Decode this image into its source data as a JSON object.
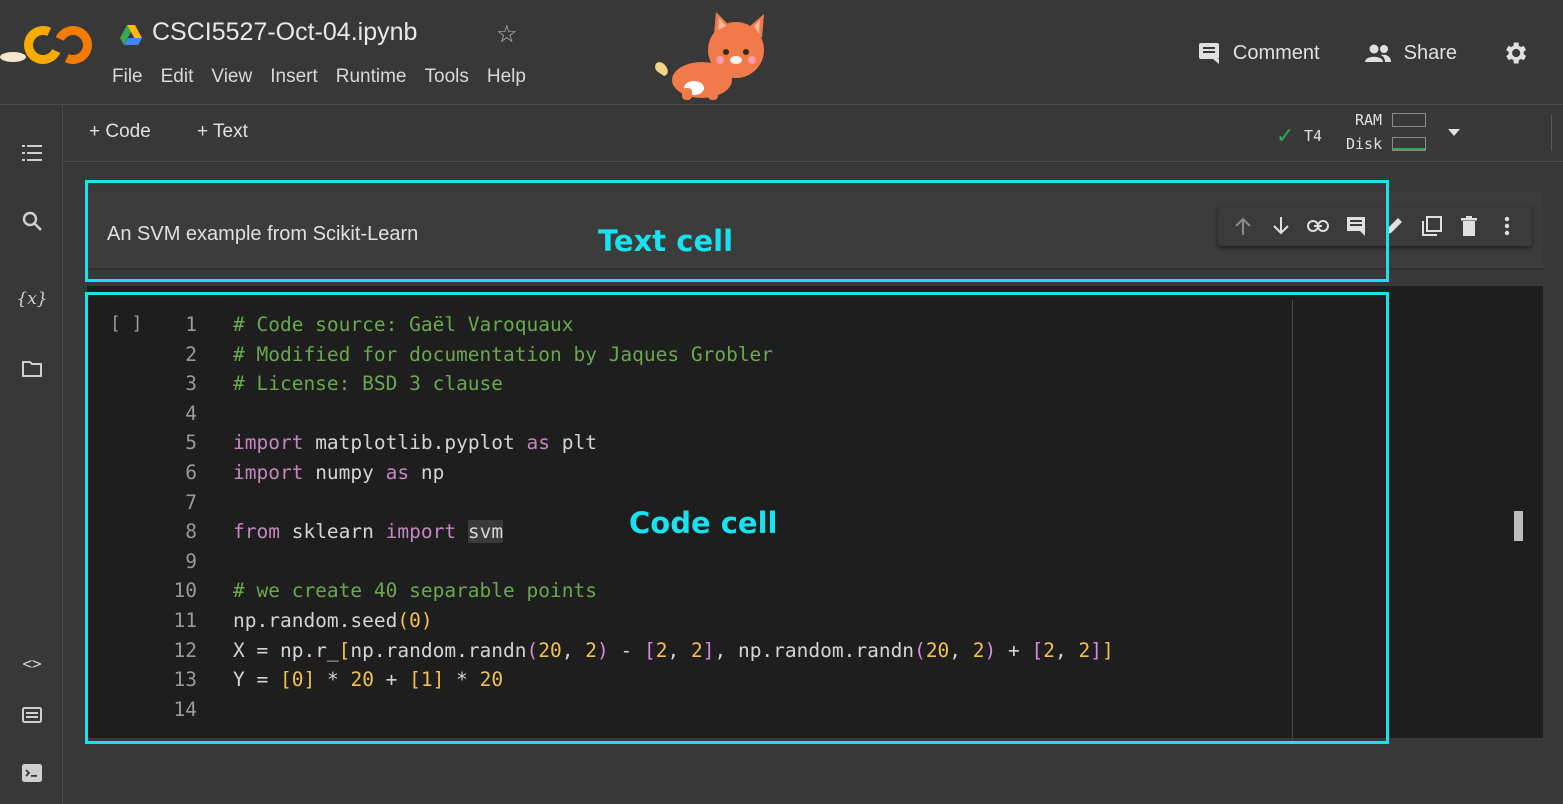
{
  "header": {
    "file_title": "CSCI5527-Oct-04.ipynb",
    "menus": [
      "File",
      "Edit",
      "View",
      "Insert",
      "Runtime",
      "Tools",
      "Help"
    ],
    "comment_label": "Comment",
    "share_label": "Share"
  },
  "toolbar": {
    "add_code_label": "+ Code",
    "add_text_label": "+ Text",
    "runtime_type": "T4",
    "ram_label": "RAM",
    "disk_label": "Disk"
  },
  "text_cell": {
    "content": "An SVM example from Scikit-Learn"
  },
  "code_cell": {
    "run_indicator": "[ ]",
    "lines": [
      {
        "num": "1",
        "text": "# Code source: Gaël Varoquaux"
      },
      {
        "num": "2",
        "text": "# Modified for documentation by Jaques Grobler"
      },
      {
        "num": "3",
        "text": "# License: BSD 3 clause"
      },
      {
        "num": "4",
        "text": ""
      },
      {
        "num": "5",
        "text": "import matplotlib.pyplot as plt"
      },
      {
        "num": "6",
        "text": "import numpy as np"
      },
      {
        "num": "7",
        "text": ""
      },
      {
        "num": "8",
        "text": "from sklearn import svm"
      },
      {
        "num": "9",
        "text": ""
      },
      {
        "num": "10",
        "text": "# we create 40 separable points"
      },
      {
        "num": "11",
        "text": "np.random.seed(0)"
      },
      {
        "num": "12",
        "text": "X = np.r_[np.random.randn(20, 2) - [2, 2], np.random.randn(20, 2) + [2, 2]]"
      },
      {
        "num": "13",
        "text": "Y = [0] * 20 + [1] * 20"
      },
      {
        "num": "14",
        "text": ""
      }
    ]
  },
  "annotations": {
    "text_cell_label": "Text cell",
    "code_cell_label": "Code cell"
  },
  "colors": {
    "annotation": "#19e2f0",
    "comment": "#6aa84f",
    "keyword": "#c586c0",
    "number": "#f2c14e",
    "bracket": "#d28adb",
    "connected_check": "#34a853"
  },
  "icons": [
    "colab-logo-icon",
    "drive-icon",
    "star-icon",
    "mascot-cat-icon",
    "comment-icon",
    "share-people-icon",
    "gear-icon",
    "toc-icon",
    "search-icon",
    "variables-icon",
    "folder-icon",
    "code-snippets-icon",
    "command-palette-icon",
    "terminal-icon",
    "check-icon",
    "caret-down-icon",
    "chevron-up-icon",
    "arrow-up-icon",
    "arrow-down-icon",
    "link-icon",
    "comment-icon",
    "edit-pencil-icon",
    "mirror-cell-icon",
    "delete-icon",
    "more-vert-icon"
  ]
}
